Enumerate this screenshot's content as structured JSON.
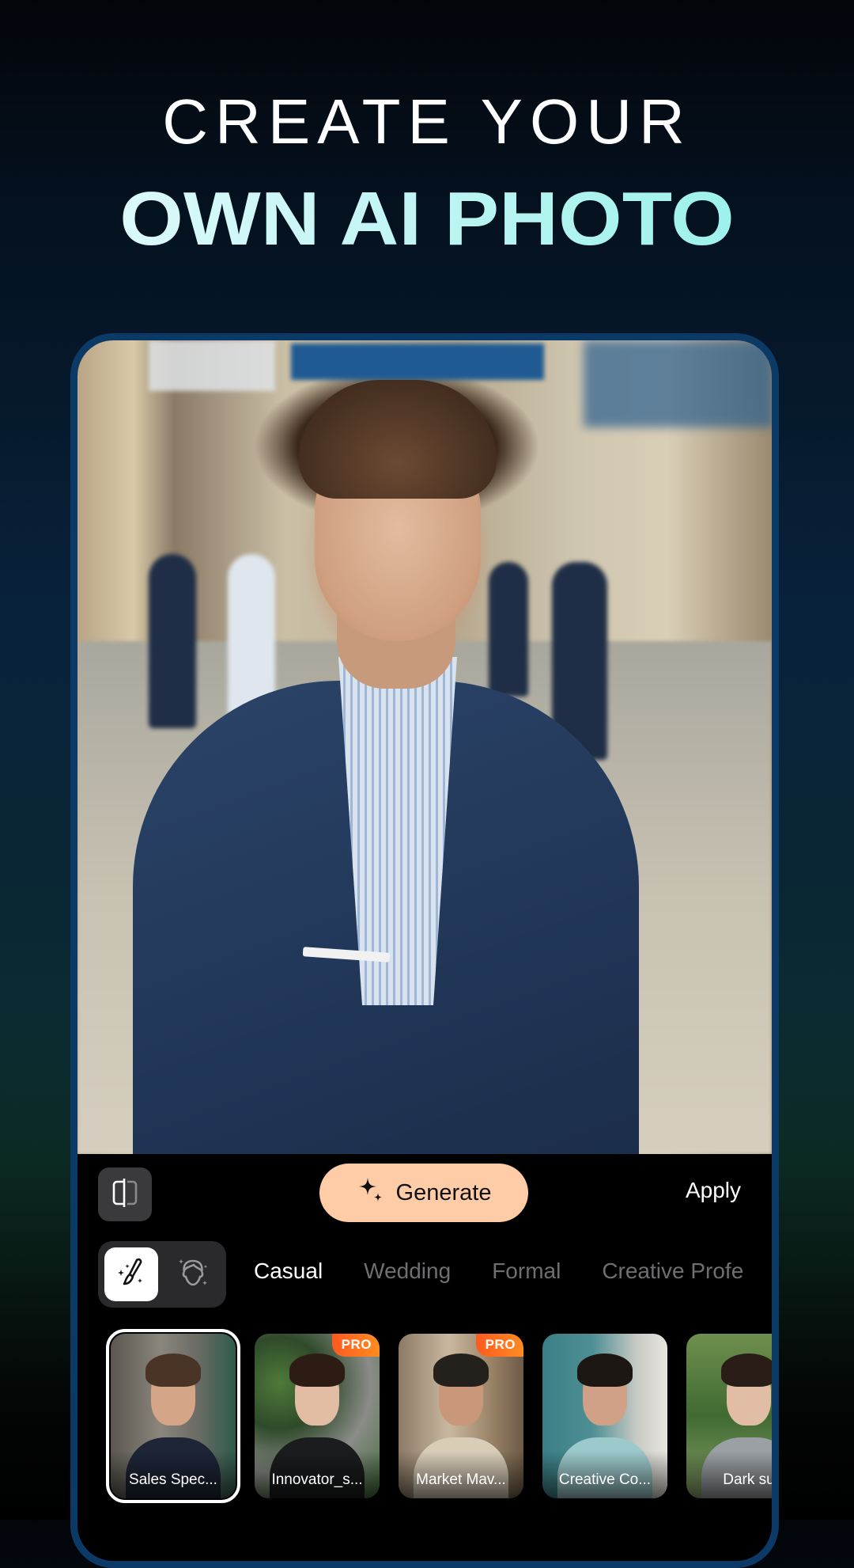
{
  "headline": {
    "line1": "CREATE YOUR",
    "line2": "OWN AI PHOTO"
  },
  "preview": {
    "subject": "Man in navy pinstripe suit with light blue striped shirt on a city street"
  },
  "toolbar": {
    "compare_icon": "compare-split-icon",
    "generate_label": "Generate",
    "generate_icon": "sparkle-icon",
    "apply_label": "Apply"
  },
  "mode_toggle": {
    "options": [
      {
        "icon": "magic-brush-icon",
        "selected": true
      },
      {
        "icon": "face-hairstyle-icon",
        "selected": false
      }
    ]
  },
  "categories": {
    "tabs": [
      {
        "label": "Casual",
        "active": true
      },
      {
        "label": "Wedding",
        "active": false
      },
      {
        "label": "Formal",
        "active": false
      },
      {
        "label": "Creative Profe",
        "active": false
      }
    ]
  },
  "styles": {
    "items": [
      {
        "label": "Sales Spec...",
        "pro": false,
        "selected": true
      },
      {
        "label": "Innovator_s...",
        "pro": true,
        "selected": false
      },
      {
        "label": "Market Mav...",
        "pro": true,
        "selected": false
      },
      {
        "label": "Creative Co...",
        "pro": false,
        "selected": false
      },
      {
        "label": "Dark su",
        "pro": false,
        "selected": false
      }
    ],
    "pro_badge_label": "PRO"
  },
  "colors": {
    "generate_bg": "#ffcca8",
    "frame_border": "#0b3a66",
    "pro_badge": "#ff6a1f",
    "headline_accent": "#a6f3ec"
  }
}
